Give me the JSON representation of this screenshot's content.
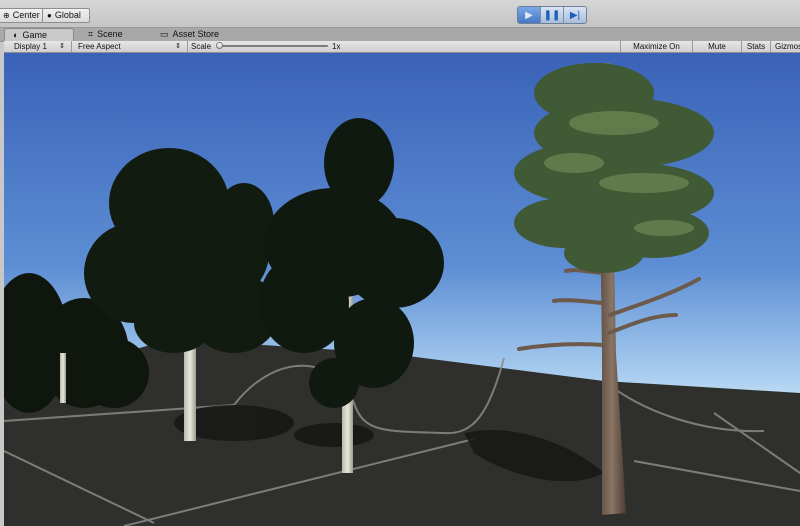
{
  "toolbar": {
    "pivot_label": "Center",
    "rotation_label": "Global",
    "play_icon": "play-icon",
    "pause_icon": "pause-icon",
    "step_icon": "step-icon"
  },
  "tabs": [
    {
      "label": "Game",
      "icon": "game-controller-icon",
      "active": true
    },
    {
      "label": "Scene",
      "icon": "grid-icon",
      "active": false
    },
    {
      "label": "Asset Store",
      "icon": "store-icon",
      "active": false
    }
  ],
  "game_bar": {
    "display": "Display 1",
    "aspect": "Free Aspect",
    "scale_label": "Scale",
    "scale_value": "1x",
    "maximize_on_play": "Maximize On Play",
    "mute_audio": "Mute Audio",
    "stats": "Stats",
    "gizmos": "Gizmos"
  },
  "colors": {
    "sky_top": "#3a62b8",
    "sky_horizon": "#d9ecf6",
    "ground": "#2f2f2d",
    "play_accent": "#4677c2"
  }
}
